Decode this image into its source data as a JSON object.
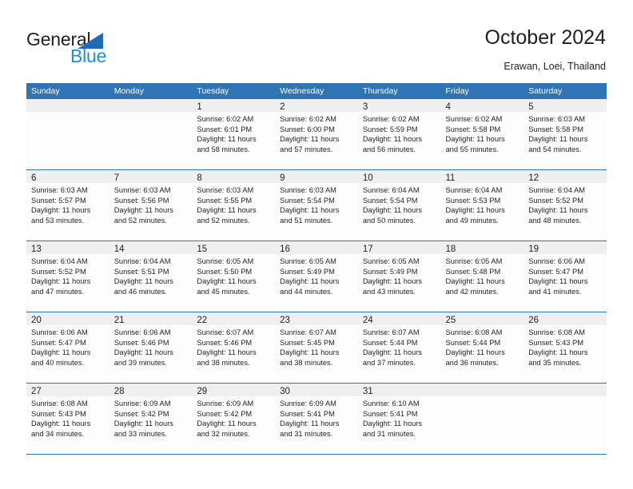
{
  "brand": {
    "name_top": "General",
    "name_bottom": "Blue",
    "triangle_color": "#1e6cb5",
    "blue_color": "#1e8fd6"
  },
  "header": {
    "title": "October 2024",
    "subtitle": "Erawan, Loei, Thailand"
  },
  "theme": {
    "header_blue": "#2f74b5",
    "daynum_band": "#efefef",
    "cell_bg": "#fdfdfd",
    "text": "#231f20"
  },
  "calendar": {
    "weekday_headers": [
      "Sunday",
      "Monday",
      "Tuesday",
      "Wednesday",
      "Thursday",
      "Friday",
      "Saturday"
    ],
    "weeks": [
      [
        {
          "day": "",
          "lines": []
        },
        {
          "day": "",
          "lines": []
        },
        {
          "day": "1",
          "lines": [
            "Sunrise: 6:02 AM",
            "Sunset: 6:01 PM",
            "Daylight: 11 hours",
            "and 58 minutes."
          ]
        },
        {
          "day": "2",
          "lines": [
            "Sunrise: 6:02 AM",
            "Sunset: 6:00 PM",
            "Daylight: 11 hours",
            "and 57 minutes."
          ]
        },
        {
          "day": "3",
          "lines": [
            "Sunrise: 6:02 AM",
            "Sunset: 5:59 PM",
            "Daylight: 11 hours",
            "and 56 minutes."
          ]
        },
        {
          "day": "4",
          "lines": [
            "Sunrise: 6:02 AM",
            "Sunset: 5:58 PM",
            "Daylight: 11 hours",
            "and 55 minutes."
          ]
        },
        {
          "day": "5",
          "lines": [
            "Sunrise: 6:03 AM",
            "Sunset: 5:58 PM",
            "Daylight: 11 hours",
            "and 54 minutes."
          ]
        }
      ],
      [
        {
          "day": "6",
          "lines": [
            "Sunrise: 6:03 AM",
            "Sunset: 5:57 PM",
            "Daylight: 11 hours",
            "and 53 minutes."
          ]
        },
        {
          "day": "7",
          "lines": [
            "Sunrise: 6:03 AM",
            "Sunset: 5:56 PM",
            "Daylight: 11 hours",
            "and 52 minutes."
          ]
        },
        {
          "day": "8",
          "lines": [
            "Sunrise: 6:03 AM",
            "Sunset: 5:55 PM",
            "Daylight: 11 hours",
            "and 52 minutes."
          ]
        },
        {
          "day": "9",
          "lines": [
            "Sunrise: 6:03 AM",
            "Sunset: 5:54 PM",
            "Daylight: 11 hours",
            "and 51 minutes."
          ]
        },
        {
          "day": "10",
          "lines": [
            "Sunrise: 6:04 AM",
            "Sunset: 5:54 PM",
            "Daylight: 11 hours",
            "and 50 minutes."
          ]
        },
        {
          "day": "11",
          "lines": [
            "Sunrise: 6:04 AM",
            "Sunset: 5:53 PM",
            "Daylight: 11 hours",
            "and 49 minutes."
          ]
        },
        {
          "day": "12",
          "lines": [
            "Sunrise: 6:04 AM",
            "Sunset: 5:52 PM",
            "Daylight: 11 hours",
            "and 48 minutes."
          ]
        }
      ],
      [
        {
          "day": "13",
          "lines": [
            "Sunrise: 6:04 AM",
            "Sunset: 5:52 PM",
            "Daylight: 11 hours",
            "and 47 minutes."
          ]
        },
        {
          "day": "14",
          "lines": [
            "Sunrise: 6:04 AM",
            "Sunset: 5:51 PM",
            "Daylight: 11 hours",
            "and 46 minutes."
          ]
        },
        {
          "day": "15",
          "lines": [
            "Sunrise: 6:05 AM",
            "Sunset: 5:50 PM",
            "Daylight: 11 hours",
            "and 45 minutes."
          ]
        },
        {
          "day": "16",
          "lines": [
            "Sunrise: 6:05 AM",
            "Sunset: 5:49 PM",
            "Daylight: 11 hours",
            "and 44 minutes."
          ]
        },
        {
          "day": "17",
          "lines": [
            "Sunrise: 6:05 AM",
            "Sunset: 5:49 PM",
            "Daylight: 11 hours",
            "and 43 minutes."
          ]
        },
        {
          "day": "18",
          "lines": [
            "Sunrise: 6:05 AM",
            "Sunset: 5:48 PM",
            "Daylight: 11 hours",
            "and 42 minutes."
          ]
        },
        {
          "day": "19",
          "lines": [
            "Sunrise: 6:06 AM",
            "Sunset: 5:47 PM",
            "Daylight: 11 hours",
            "and 41 minutes."
          ]
        }
      ],
      [
        {
          "day": "20",
          "lines": [
            "Sunrise: 6:06 AM",
            "Sunset: 5:47 PM",
            "Daylight: 11 hours",
            "and 40 minutes."
          ]
        },
        {
          "day": "21",
          "lines": [
            "Sunrise: 6:06 AM",
            "Sunset: 5:46 PM",
            "Daylight: 11 hours",
            "and 39 minutes."
          ]
        },
        {
          "day": "22",
          "lines": [
            "Sunrise: 6:07 AM",
            "Sunset: 5:46 PM",
            "Daylight: 11 hours",
            "and 38 minutes."
          ]
        },
        {
          "day": "23",
          "lines": [
            "Sunrise: 6:07 AM",
            "Sunset: 5:45 PM",
            "Daylight: 11 hours",
            "and 38 minutes."
          ]
        },
        {
          "day": "24",
          "lines": [
            "Sunrise: 6:07 AM",
            "Sunset: 5:44 PM",
            "Daylight: 11 hours",
            "and 37 minutes."
          ]
        },
        {
          "day": "25",
          "lines": [
            "Sunrise: 6:08 AM",
            "Sunset: 5:44 PM",
            "Daylight: 11 hours",
            "and 36 minutes."
          ]
        },
        {
          "day": "26",
          "lines": [
            "Sunrise: 6:08 AM",
            "Sunset: 5:43 PM",
            "Daylight: 11 hours",
            "and 35 minutes."
          ]
        }
      ],
      [
        {
          "day": "27",
          "lines": [
            "Sunrise: 6:08 AM",
            "Sunset: 5:43 PM",
            "Daylight: 11 hours",
            "and 34 minutes."
          ]
        },
        {
          "day": "28",
          "lines": [
            "Sunrise: 6:09 AM",
            "Sunset: 5:42 PM",
            "Daylight: 11 hours",
            "and 33 minutes."
          ]
        },
        {
          "day": "29",
          "lines": [
            "Sunrise: 6:09 AM",
            "Sunset: 5:42 PM",
            "Daylight: 11 hours",
            "and 32 minutes."
          ]
        },
        {
          "day": "30",
          "lines": [
            "Sunrise: 6:09 AM",
            "Sunset: 5:41 PM",
            "Daylight: 11 hours",
            "and 31 minutes."
          ]
        },
        {
          "day": "31",
          "lines": [
            "Sunrise: 6:10 AM",
            "Sunset: 5:41 PM",
            "Daylight: 11 hours",
            "and 31 minutes."
          ]
        },
        {
          "day": "",
          "lines": []
        },
        {
          "day": "",
          "lines": []
        }
      ]
    ]
  }
}
